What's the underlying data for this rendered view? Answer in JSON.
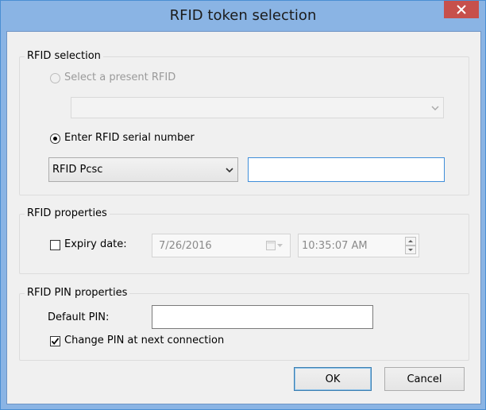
{
  "window": {
    "title": "RFID token selection"
  },
  "icons": {
    "close": "close-icon",
    "dropdown": "chevron-down-icon",
    "calendar": "calendar-icon",
    "checkmark": "checkmark-icon",
    "spin_up": "triangle-up-icon",
    "spin_down": "triangle-down-icon"
  },
  "rfid_selection": {
    "group_label": "RFID selection",
    "present_label": "Select a present RFID",
    "present_selected": false,
    "present_enabled": false,
    "present_combo_value": "",
    "serial_label": "Enter RFID serial number",
    "serial_selected": true,
    "reader_value": "RFID Pcsc",
    "serial_value": ""
  },
  "rfid_properties": {
    "group_label": "RFID properties",
    "expiry_label": "Expiry date:",
    "expiry_checked": false,
    "date_value": "7/26/2016",
    "time_value": "10:35:07 AM"
  },
  "pin_properties": {
    "group_label": "RFID PIN properties",
    "default_pin_label": "Default PIN:",
    "default_pin_value": "",
    "change_pin_label": "Change PIN at next connection",
    "change_pin_checked": true
  },
  "buttons": {
    "ok": "OK",
    "cancel": "Cancel"
  },
  "colors": {
    "titlebar": "#8ab4e4",
    "close": "#c7504b",
    "client_bg": "#f0f0f0",
    "focus_border": "#3f8ed9"
  }
}
